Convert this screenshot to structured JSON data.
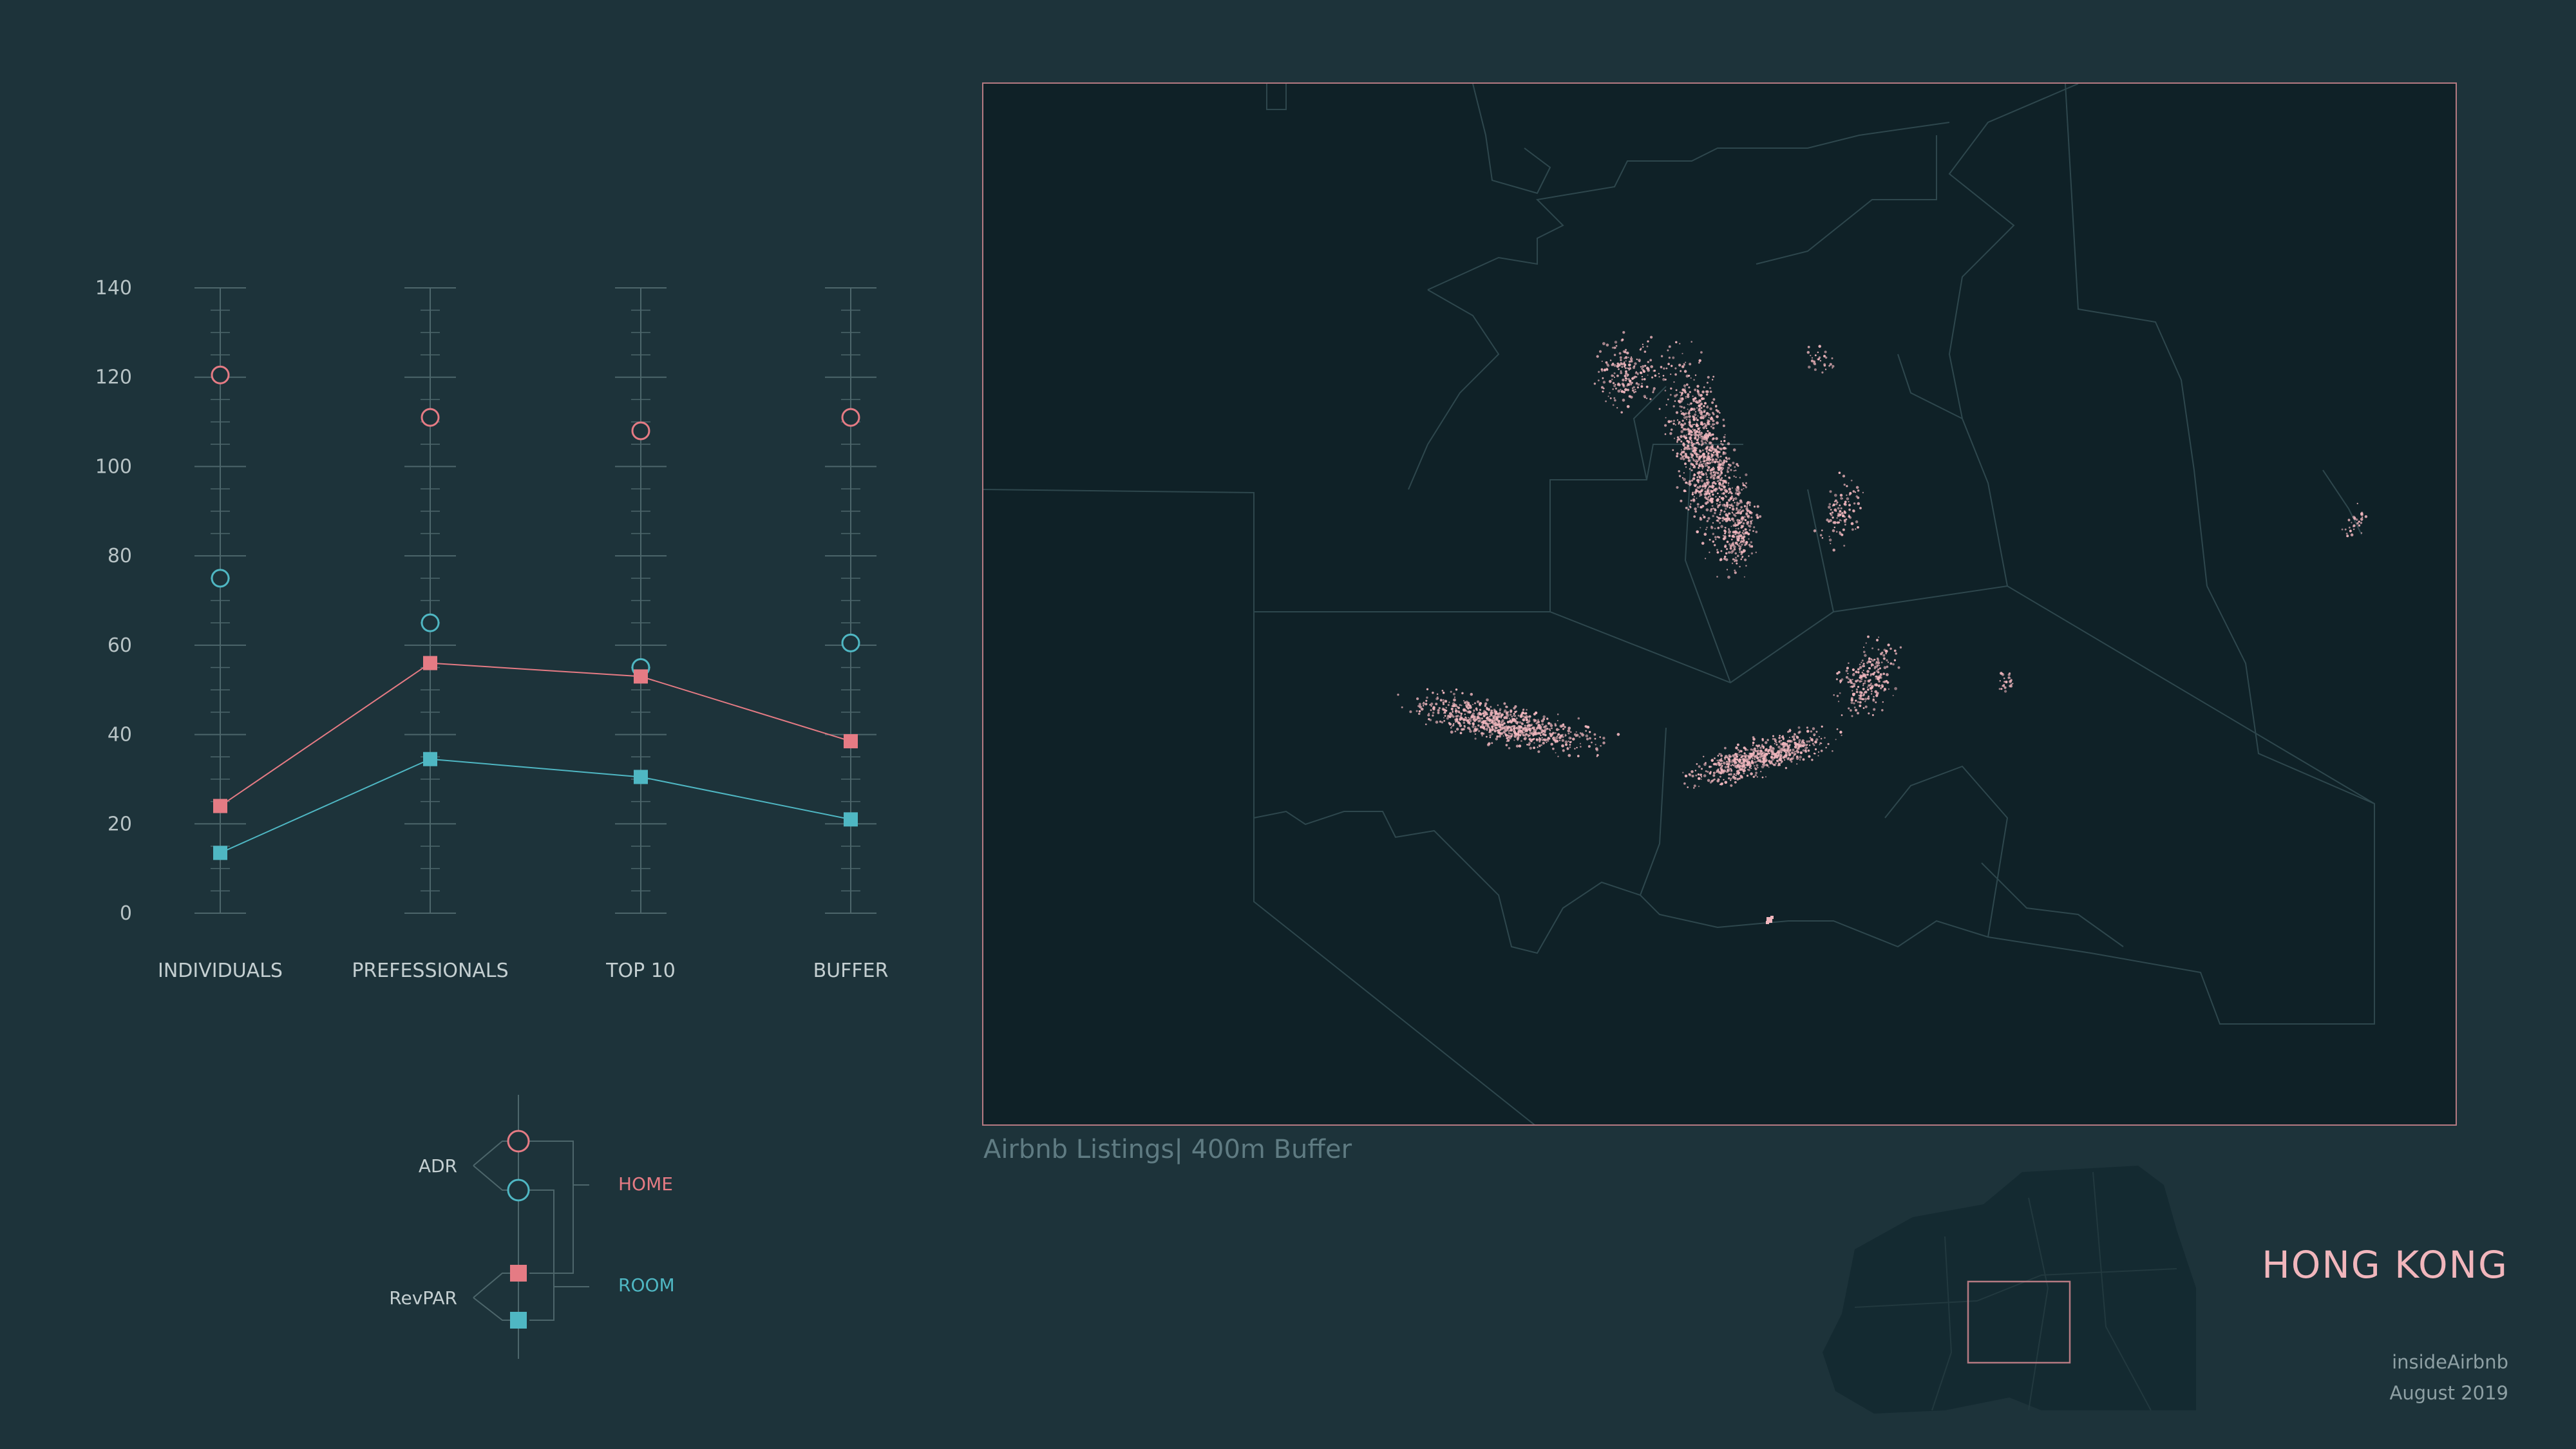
{
  "chart_data": {
    "type": "line",
    "categories": [
      "INDIVIDUALS",
      "PREFESSIONALS",
      "TOP 10",
      "BUFFER"
    ],
    "ylim": [
      0,
      140
    ],
    "y_ticks": [
      0,
      20,
      40,
      60,
      80,
      100,
      120,
      140
    ],
    "series": [
      {
        "name": "ADR HOME",
        "marker": "circle-open",
        "color": "#e57b84",
        "connected": false,
        "values": [
          120.5,
          111,
          108,
          111
        ]
      },
      {
        "name": "ADR ROOM",
        "marker": "circle-open",
        "color": "#4fb7c3",
        "connected": false,
        "values": [
          75,
          65,
          55,
          60.5
        ]
      },
      {
        "name": "RevPAR HOME",
        "marker": "square-filled",
        "color": "#e57b84",
        "connected": true,
        "values": [
          24,
          56,
          53,
          38.5
        ]
      },
      {
        "name": "RevPAR ROOM",
        "marker": "square-filled",
        "color": "#4fb7c3",
        "connected": true,
        "values": [
          13.5,
          34.5,
          30.5,
          21
        ]
      }
    ],
    "grid": false
  },
  "legend": {
    "adr_label": "ADR",
    "revpar_label": "RevPAR",
    "home_label": "HOME",
    "room_label": "ROOM"
  },
  "map": {
    "caption": "Airbnb Listings| 400m Buffer",
    "point_color": "#f0b6bd",
    "frame_color": "#b57a82"
  },
  "footer": {
    "city": "HONG KONG",
    "source": "insideAirbnb",
    "date": "August 2019"
  },
  "colors": {
    "background": "#1d333a",
    "home": "#e57b84",
    "room": "#4fb7c3",
    "axis": "#4d666b"
  }
}
